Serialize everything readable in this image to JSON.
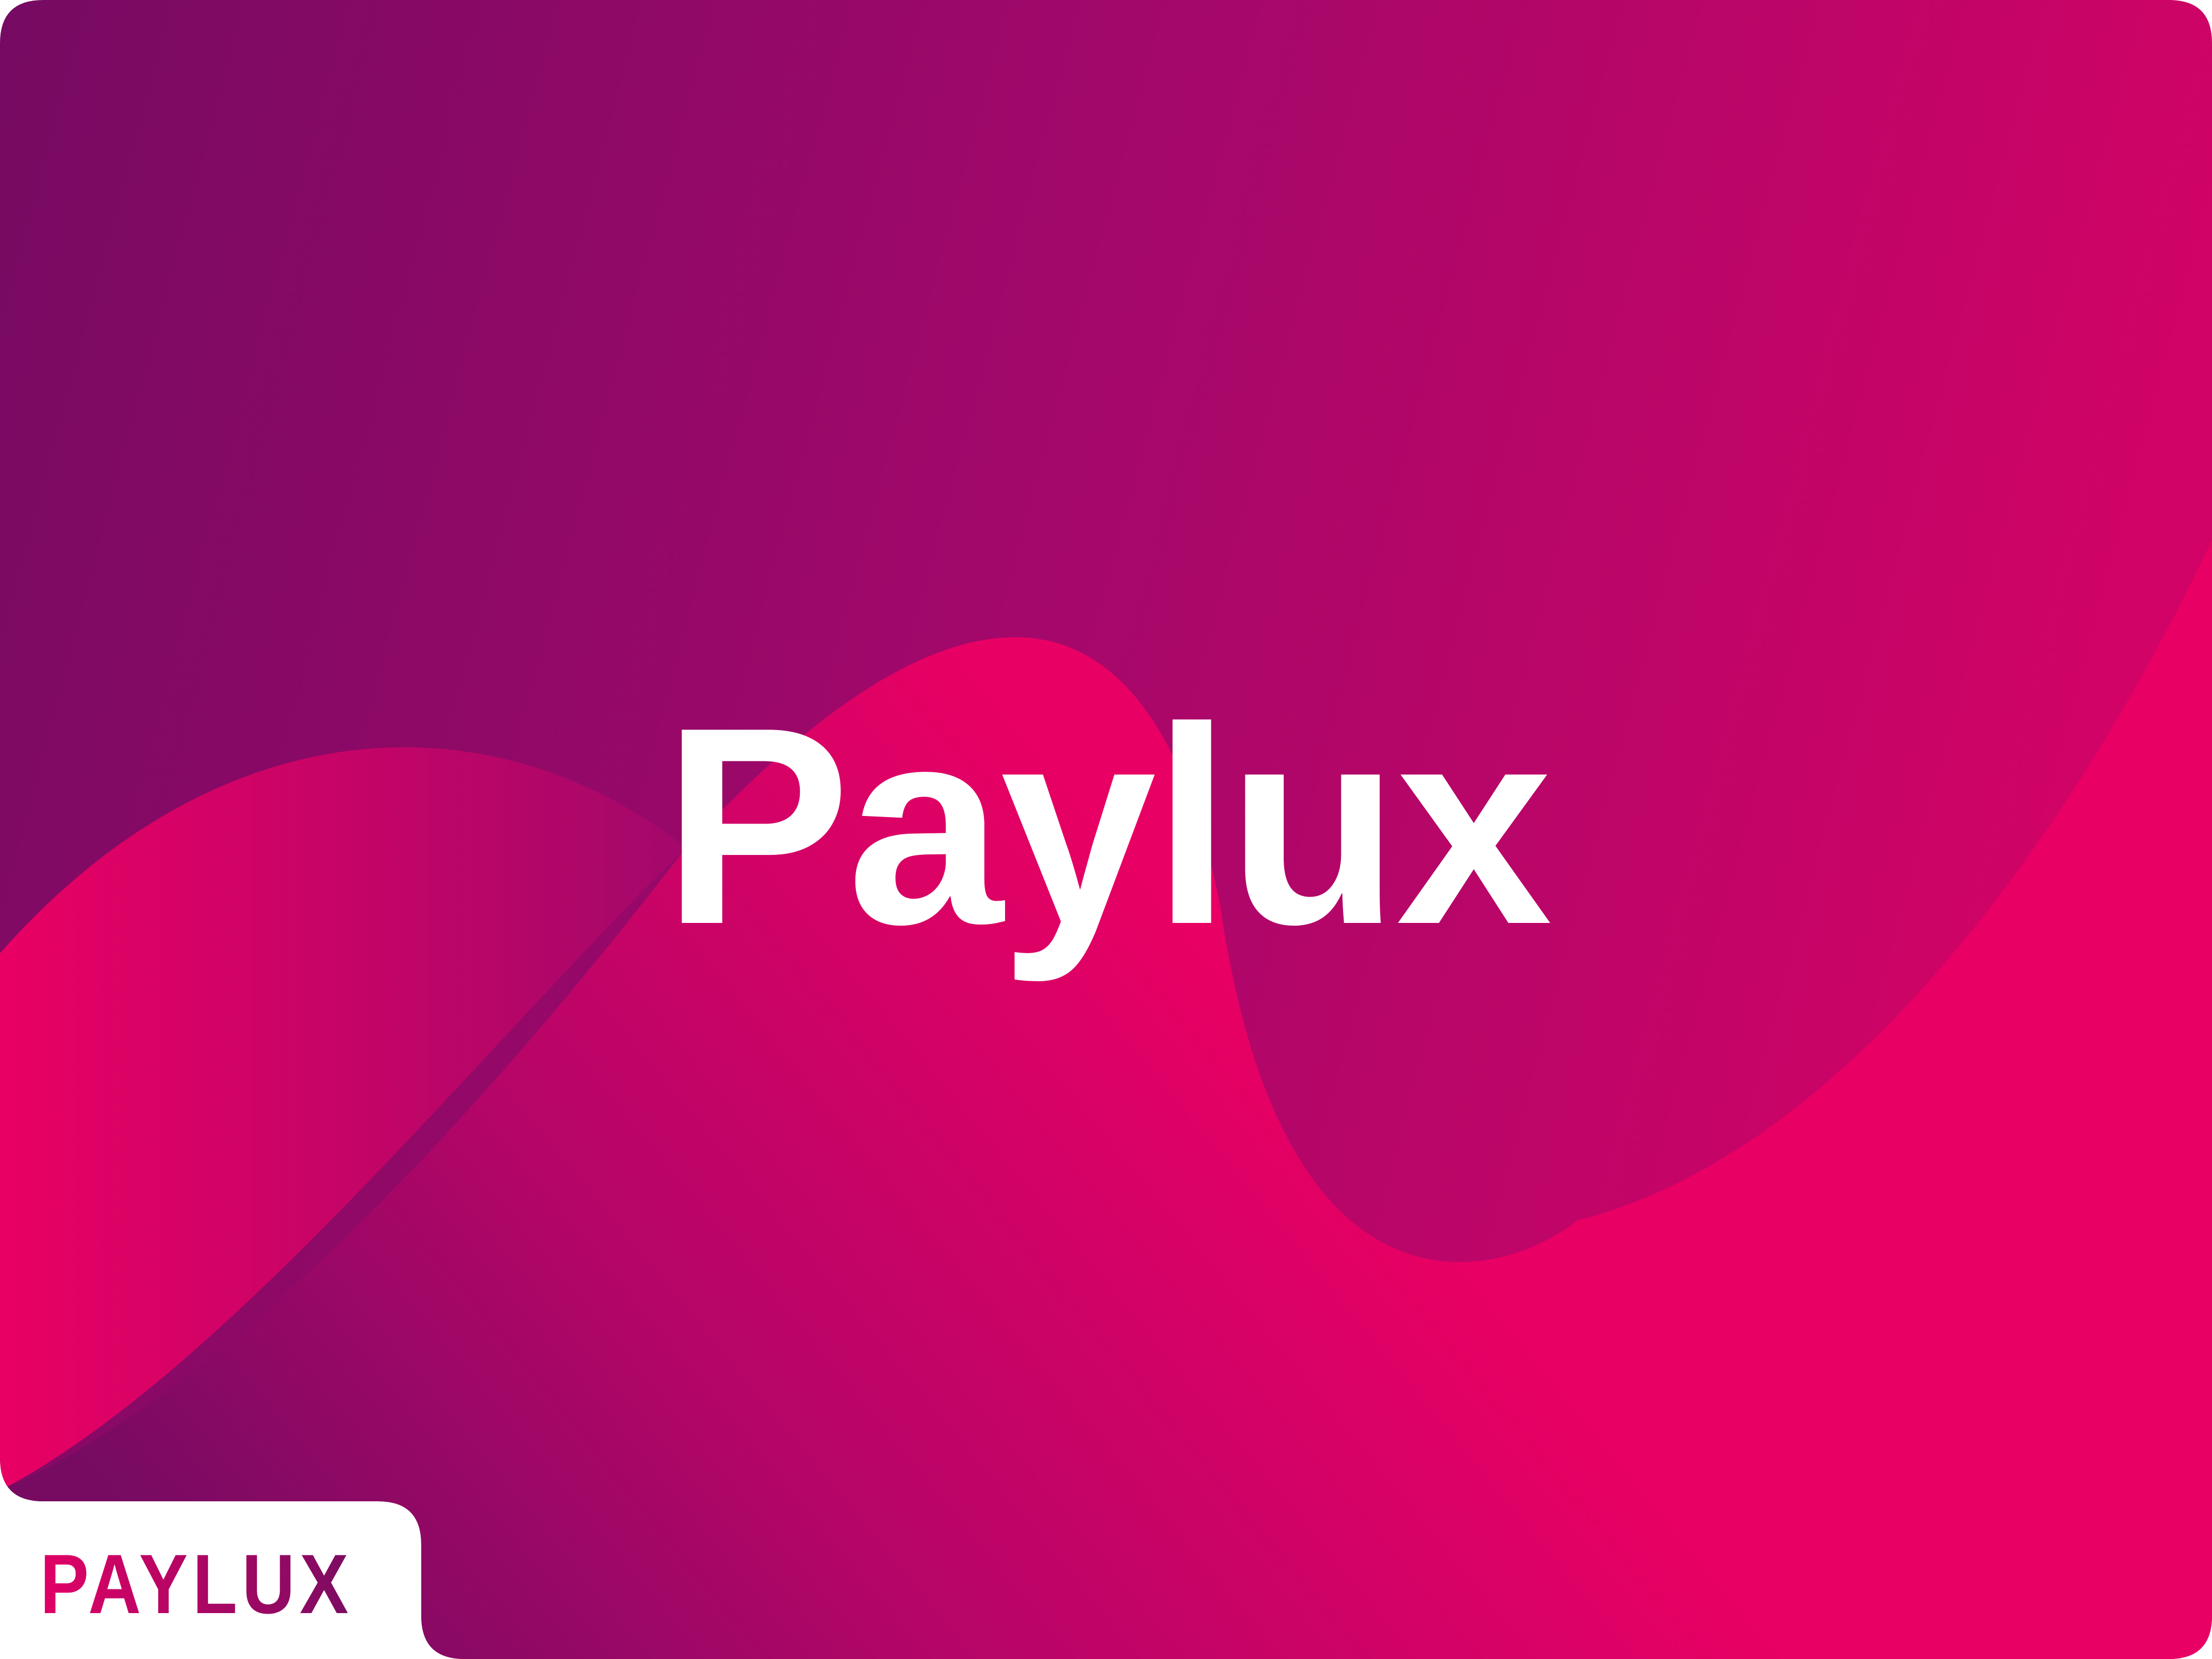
{
  "hero": {
    "title": "Paylux"
  },
  "brand": {
    "logo_text": "PAYLUX"
  },
  "colors": {
    "plum_dark": "#760A62",
    "magenta_mid": "#A2086A",
    "pink_bright": "#E90064",
    "logo_plum": "#7B0C62",
    "logo_pink": "#E20066",
    "text_white": "#FFFFFF",
    "tab_white": "#FFFFFF"
  }
}
